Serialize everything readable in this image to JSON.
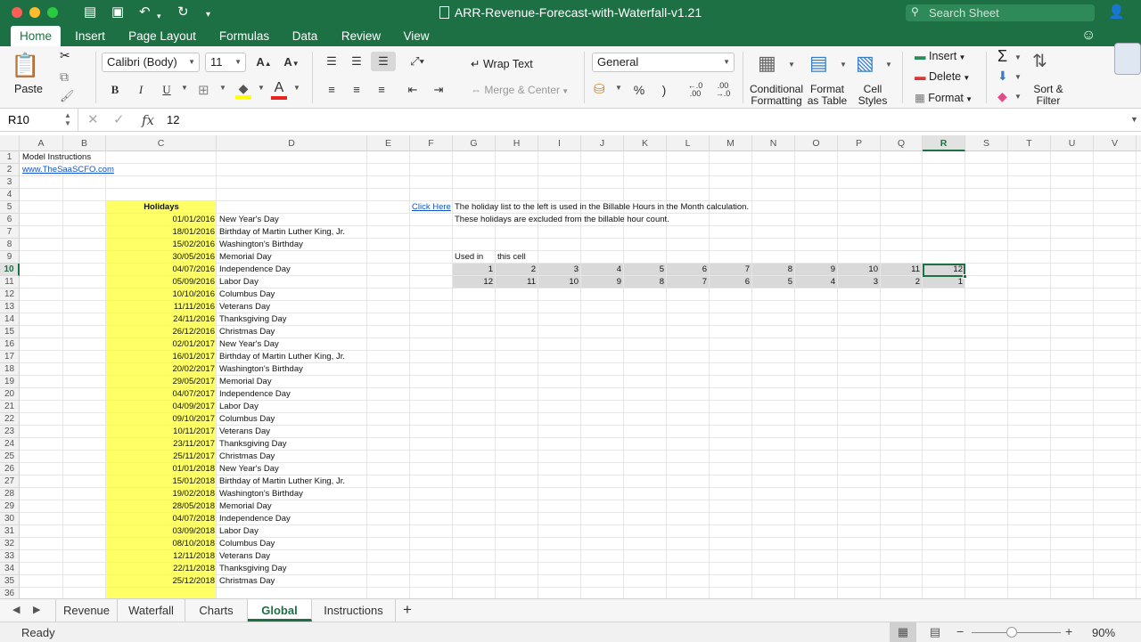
{
  "window": {
    "title": "ARR-Revenue-Forecast-with-Waterfall-v1.21",
    "search_placeholder": "Search Sheet"
  },
  "ribbon_tabs": [
    "Home",
    "Insert",
    "Page Layout",
    "Formulas",
    "Data",
    "Review",
    "View"
  ],
  "active_tab": "Home",
  "ribbon": {
    "paste": "Paste",
    "font_name": "Calibri (Body)",
    "font_size": "11",
    "wrap_text": "Wrap Text",
    "merge_center": "Merge & Center",
    "number_format": "General",
    "percent": "%",
    "comma": ")",
    "conditional": [
      "Conditional",
      "Formatting"
    ],
    "format_table": [
      "Format",
      "as Table"
    ],
    "cell_styles": [
      "Cell",
      "Styles"
    ],
    "insert": "Insert",
    "delete": "Delete",
    "format": "Format",
    "sort_filter": [
      "Sort &",
      "Filter"
    ],
    "bold": "B",
    "italic": "I",
    "underline": "U",
    "font_color_letter": "A",
    "inc_font": "A",
    "dec_font": "A"
  },
  "formula_bar": {
    "name_box": "R10",
    "fx": "fx",
    "value": "12"
  },
  "columns": [
    "A",
    "B",
    "C",
    "D",
    "E",
    "F",
    "G",
    "H",
    "I",
    "J",
    "K",
    "L",
    "M",
    "N",
    "O",
    "P",
    "Q",
    "R",
    "S",
    "T",
    "U",
    "V"
  ],
  "selected_column": "R",
  "rows": [
    "1",
    "2",
    "3",
    "4",
    "5",
    "6",
    "7",
    "8",
    "9",
    "10",
    "11",
    "12",
    "13",
    "14",
    "15",
    "16",
    "17",
    "18",
    "19",
    "20",
    "21",
    "22",
    "23",
    "24",
    "25",
    "26",
    "27",
    "28",
    "29",
    "30",
    "31",
    "32",
    "33",
    "34",
    "35",
    "36"
  ],
  "selected_row": "10",
  "sheet": {
    "a1": "Model Instructions",
    "a2": "www.TheSaaSCFO.com",
    "holidays_header": "Holidays",
    "click_here": "Click Here",
    "note1": "The holiday list to the left is used in the Billable Hours in the Month calculation.",
    "note2": "These holidays are excluded from the billable hour count.",
    "used_in": "Used in",
    "this_cell": "this cell",
    "row10": [
      "1",
      "2",
      "3",
      "4",
      "5",
      "6",
      "7",
      "8",
      "9",
      "10",
      "11",
      "12"
    ],
    "row11": [
      "12",
      "11",
      "10",
      "9",
      "8",
      "7",
      "6",
      "5",
      "4",
      "3",
      "2",
      "1"
    ],
    "holidays": [
      {
        "date": "01/01/2016",
        "name": "New Year's Day"
      },
      {
        "date": "18/01/2016",
        "name": "Birthday of Martin Luther King, Jr."
      },
      {
        "date": "15/02/2016",
        "name": "Washington's Birthday"
      },
      {
        "date": "30/05/2016",
        "name": "Memorial Day"
      },
      {
        "date": "04/07/2016",
        "name": "Independence Day"
      },
      {
        "date": "05/09/2016",
        "name": "Labor Day"
      },
      {
        "date": "10/10/2016",
        "name": "Columbus Day"
      },
      {
        "date": "11/11/2016",
        "name": "Veterans Day"
      },
      {
        "date": "24/11/2016",
        "name": "Thanksgiving Day"
      },
      {
        "date": "26/12/2016",
        "name": "Christmas Day"
      },
      {
        "date": "02/01/2017",
        "name": "New Year's Day"
      },
      {
        "date": "16/01/2017",
        "name": "Birthday of Martin Luther King, Jr."
      },
      {
        "date": "20/02/2017",
        "name": "Washington's Birthday"
      },
      {
        "date": "29/05/2017",
        "name": "Memorial Day"
      },
      {
        "date": "04/07/2017",
        "name": "Independence Day"
      },
      {
        "date": "04/09/2017",
        "name": "Labor Day"
      },
      {
        "date": "09/10/2017",
        "name": "Columbus Day"
      },
      {
        "date": "10/11/2017",
        "name": "Veterans Day"
      },
      {
        "date": "23/11/2017",
        "name": "Thanksgiving Day"
      },
      {
        "date": "25/11/2017",
        "name": "Christmas Day"
      },
      {
        "date": "01/01/2018",
        "name": "New Year's Day"
      },
      {
        "date": "15/01/2018",
        "name": "Birthday of Martin Luther King, Jr."
      },
      {
        "date": "19/02/2018",
        "name": "Washington's Birthday"
      },
      {
        "date": "28/05/2018",
        "name": "Memorial Day"
      },
      {
        "date": "04/07/2018",
        "name": "Independence Day"
      },
      {
        "date": "03/09/2018",
        "name": "Labor Day"
      },
      {
        "date": "08/10/2018",
        "name": "Columbus Day"
      },
      {
        "date": "12/11/2018",
        "name": "Veterans Day"
      },
      {
        "date": "22/11/2018",
        "name": "Thanksgiving Day"
      },
      {
        "date": "25/12/2018",
        "name": "Christmas Day"
      }
    ]
  },
  "sheet_tabs": [
    "Revenue",
    "Waterfall",
    "Charts",
    "Global",
    "Instructions"
  ],
  "active_sheet": "Global",
  "status": {
    "text": "Ready",
    "zoom": "90%"
  },
  "colors": {
    "excel_green": "#1d7044",
    "holiday_fill": "#ffff66",
    "month_fill": "#d9d9d9",
    "link": "#1155cc"
  }
}
